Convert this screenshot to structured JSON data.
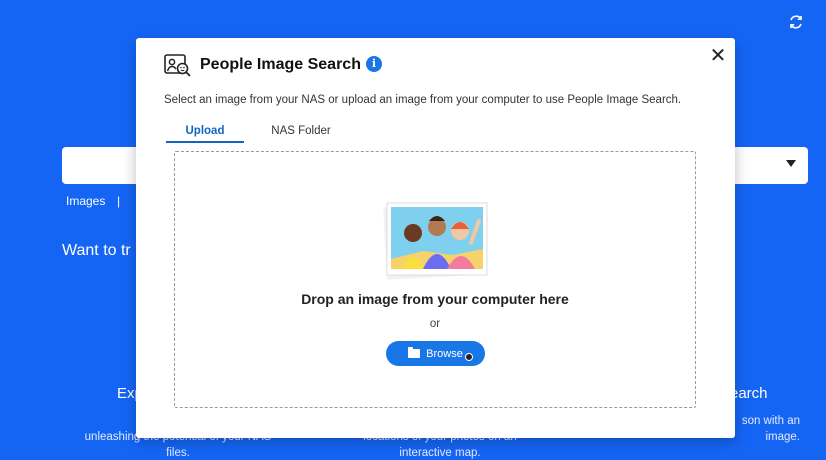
{
  "background": {
    "filter_label": "Images",
    "filter_separator": "|",
    "heading": "Want to tr",
    "cards": [
      {
        "title": "Exp",
        "text": "Enhance y\nunleashing the potential of your NAS\nfiles."
      },
      {
        "title": "",
        "text": "locations of your photos on an\ninteractive map."
      },
      {
        "title": "earch",
        "text": "son with an\nimage."
      }
    ]
  },
  "modal": {
    "title": "People Image Search",
    "instructions": "Select an image from your NAS or upload an image from your computer to use People Image Search.",
    "tabs": [
      {
        "label": "Upload",
        "active": true
      },
      {
        "label": "NAS Folder",
        "active": false
      }
    ],
    "dropzone": {
      "drop_text": "Drop an image from your computer here",
      "or_text": "or",
      "browse_label": "Browse"
    }
  },
  "colors": {
    "background": "#1565f5",
    "accent": "#1976e6",
    "tab_active": "#1565c0"
  },
  "icons": [
    "refresh-icon",
    "chevron-down-icon",
    "people-search-icon",
    "info-icon",
    "close-icon",
    "folder-icon",
    "people-photo-illustration",
    "cursor-icon"
  ]
}
